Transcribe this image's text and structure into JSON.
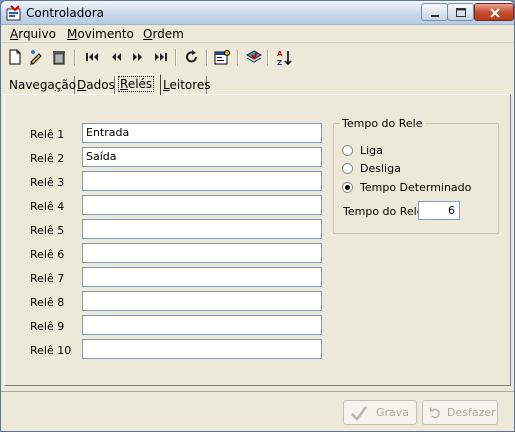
{
  "window": {
    "title": "Controladora",
    "icon": "form-app-icon",
    "controls": [
      "minimize-icon",
      "maximize-icon",
      "close-icon"
    ]
  },
  "menu": {
    "items": [
      {
        "first": "A",
        "rest": "rquivo"
      },
      {
        "first": "M",
        "rest": "ovimento"
      },
      {
        "first": "O",
        "rest": "rdem"
      }
    ]
  },
  "toolbar": {
    "icons": [
      "new-document-icon",
      "edit-pencil-icon",
      "delete-trash-icon",
      "first-record-icon",
      "previous-record-icon",
      "next-record-icon",
      "last-record-icon",
      "refresh-icon",
      "properties-icon",
      "dataset-icon",
      "sort-az-icon"
    ]
  },
  "tabs": [
    {
      "pre": "Navega",
      "u": "ç",
      "post": "ão"
    },
    {
      "pre": "",
      "u": "D",
      "post": "ados"
    },
    {
      "pre": "",
      "u": "R",
      "post": "elés"
    },
    {
      "pre": "",
      "u": "L",
      "post": "eitores"
    }
  ],
  "relays": {
    "rows": [
      {
        "label": "Relê 1",
        "value": "Entrada"
      },
      {
        "label": "Relê 2",
        "value": "Saída"
      },
      {
        "label": "Relê 3",
        "value": ""
      },
      {
        "label": "Relê 4",
        "value": ""
      },
      {
        "label": "Relê 5",
        "value": ""
      },
      {
        "label": "Relê 6",
        "value": ""
      },
      {
        "label": "Relê 7",
        "value": ""
      },
      {
        "label": "Relê 8",
        "value": ""
      },
      {
        "label": "Relê 9",
        "value": ""
      },
      {
        "label": "Relê 10",
        "value": ""
      }
    ]
  },
  "timer_group": {
    "title": "Tempo do Rele",
    "options": [
      {
        "label": "Liga",
        "selected": false
      },
      {
        "label": "Desliga",
        "selected": false
      },
      {
        "label": "Tempo Determinado",
        "selected": true
      }
    ],
    "time_label": "Tempo do Rele",
    "time_value": "6"
  },
  "buttons": {
    "save_label": "Grava",
    "undo_label": "Desfazer"
  },
  "colors": {
    "accent_close": "#c54a2c",
    "disabled_text": "#aca899",
    "window_bg": "#ece9d8"
  }
}
